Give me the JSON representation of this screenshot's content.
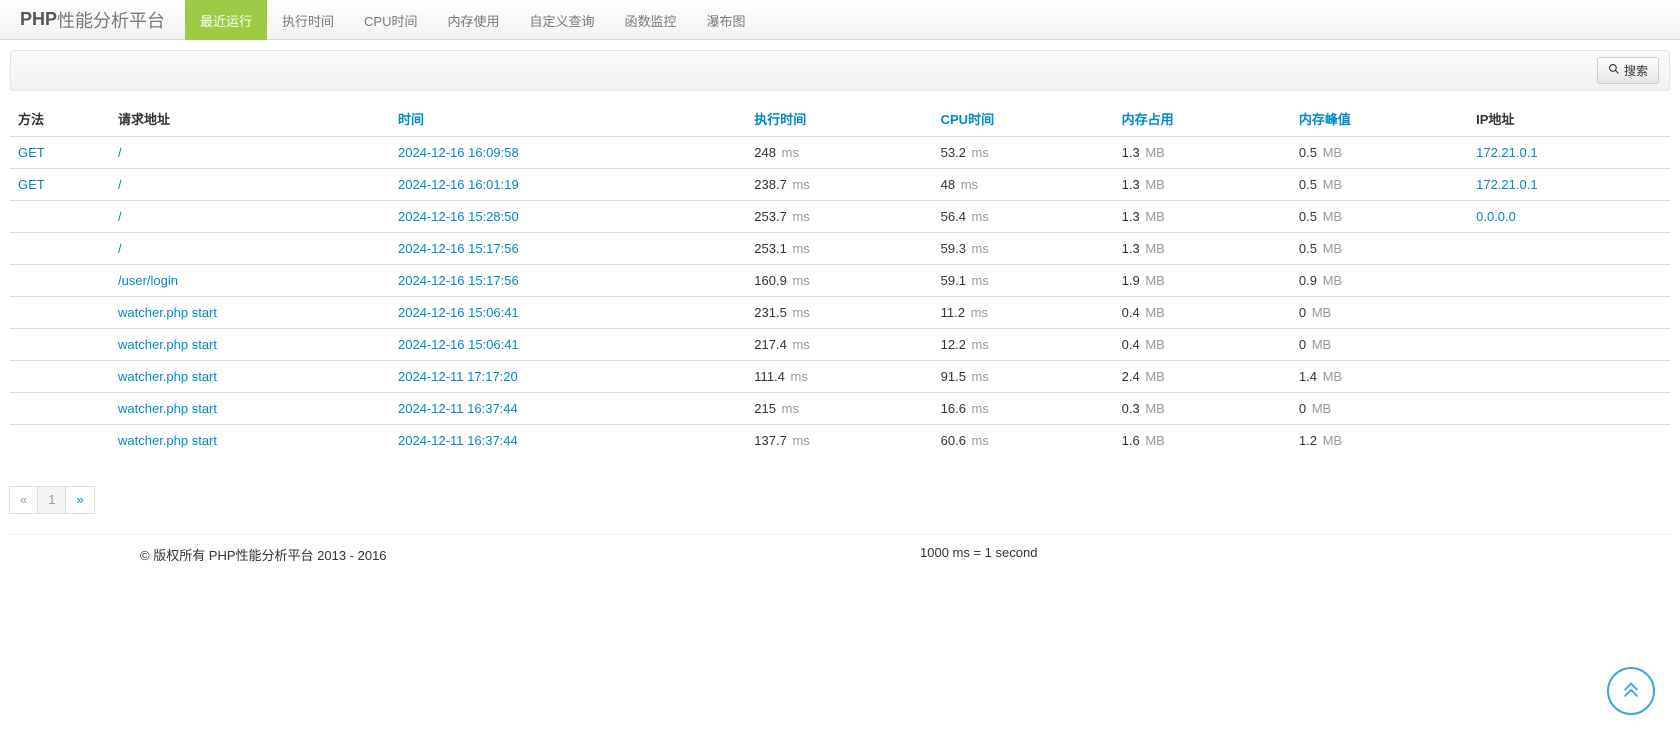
{
  "brand": {
    "bold": "PHP",
    "rest": "性能分析平台"
  },
  "nav": [
    {
      "label": "最近运行",
      "active": true
    },
    {
      "label": "执行时间"
    },
    {
      "label": "CPU时间"
    },
    {
      "label": "内存使用"
    },
    {
      "label": "自定义查询"
    },
    {
      "label": "函数监控"
    },
    {
      "label": "瀑布图"
    }
  ],
  "toolbar": {
    "search_btn": "搜索"
  },
  "columns": {
    "method": "方法",
    "url": "请求地址",
    "time": "时间",
    "wt": "执行时间",
    "cpu": "CPU时间",
    "mu": "内存占用",
    "pmu": "内存峰值",
    "ip": "IP地址"
  },
  "units": {
    "ms": "ms",
    "mb": "MB"
  },
  "rows": [
    {
      "method": "GET",
      "url": "/",
      "time": "2024-12-16 16:09:58",
      "wt": "248",
      "cpu": "53.2",
      "mu": "1.3",
      "pmu": "0.5",
      "ip": "172.21.0.1"
    },
    {
      "method": "GET",
      "url": "/",
      "time": "2024-12-16 16:01:19",
      "wt": "238.7",
      "cpu": "48",
      "mu": "1.3",
      "pmu": "0.5",
      "ip": "172.21.0.1"
    },
    {
      "method": "",
      "url": "/",
      "time": "2024-12-16 15:28:50",
      "wt": "253.7",
      "cpu": "56.4",
      "mu": "1.3",
      "pmu": "0.5",
      "ip": "0.0.0.0"
    },
    {
      "method": "",
      "url": "/",
      "time": "2024-12-16 15:17:56",
      "wt": "253.1",
      "cpu": "59.3",
      "mu": "1.3",
      "pmu": "0.5",
      "ip": ""
    },
    {
      "method": "",
      "url": "/user/login",
      "time": "2024-12-16 15:17:56",
      "wt": "160.9",
      "cpu": "59.1",
      "mu": "1.9",
      "pmu": "0.9",
      "ip": ""
    },
    {
      "method": "",
      "url": "watcher.php start",
      "time": "2024-12-16 15:06:41",
      "wt": "231.5",
      "cpu": "11.2",
      "mu": "0.4",
      "pmu": "0",
      "ip": ""
    },
    {
      "method": "",
      "url": "watcher.php start",
      "time": "2024-12-16 15:06:41",
      "wt": "217.4",
      "cpu": "12.2",
      "mu": "0.4",
      "pmu": "0",
      "ip": ""
    },
    {
      "method": "",
      "url": "watcher.php start",
      "time": "2024-12-11 17:17:20",
      "wt": "111.4",
      "cpu": "91.5",
      "mu": "2.4",
      "pmu": "1.4",
      "ip": ""
    },
    {
      "method": "",
      "url": "watcher.php start",
      "time": "2024-12-11 16:37:44",
      "wt": "215",
      "cpu": "16.6",
      "mu": "0.3",
      "pmu": "0",
      "ip": ""
    },
    {
      "method": "",
      "url": "watcher.php start",
      "time": "2024-12-11 16:37:44",
      "wt": "137.7",
      "cpu": "60.6",
      "mu": "1.6",
      "pmu": "1.2",
      "ip": ""
    }
  ],
  "pagination": {
    "prev": "«",
    "pages": [
      "1"
    ],
    "next": "»",
    "active": "1"
  },
  "footer": {
    "copyright": "© 版权所有 PHP性能分析平台 2013 - 2016",
    "note": "1000 ms = 1 second"
  }
}
